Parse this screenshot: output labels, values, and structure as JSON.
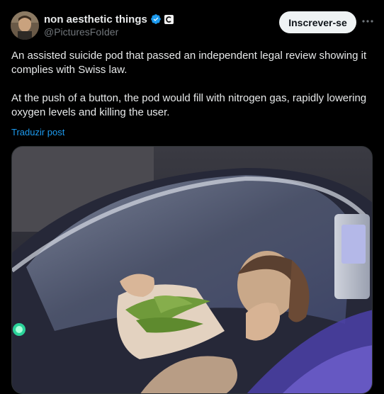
{
  "post": {
    "author": {
      "display_name": "non aesthetic things",
      "handle": "@PicturesFoIder",
      "avatar_icon": "avatar-photo",
      "verified_icon": "verified-badge-icon",
      "affiliate_icon": "affiliate-badge-icon"
    },
    "subscribe_label": "Inscrever-se",
    "more_icon": "more-options-icon",
    "paragraphs": [
      "An assisted suicide pod that passed an independent legal review showing it complies with Swiss law.",
      "At the push of a button, the pod would fill with nitrogen gas, rapidly lowering oxygen levels and killing the user."
    ],
    "translate_label": "Traduzir post",
    "media": {
      "kind": "photo"
    }
  },
  "colors": {
    "background": "#000000",
    "text_primary": "#e7e9ea",
    "text_secondary": "#71767b",
    "link": "#1d9bf0",
    "verified": "#1d9bf0",
    "button_bg": "#eff3f4"
  }
}
